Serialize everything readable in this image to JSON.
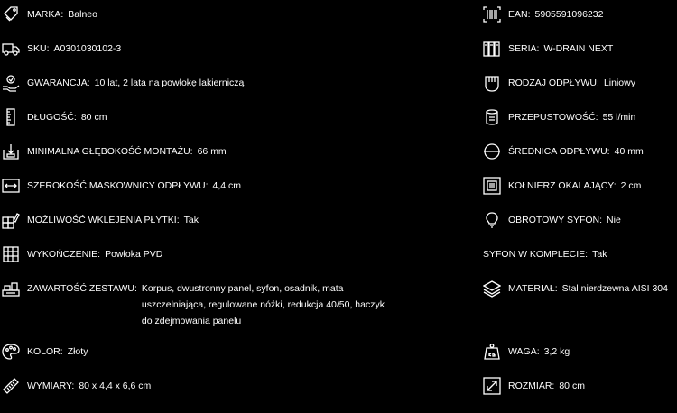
{
  "left": [
    {
      "icon": "tag-icon",
      "label": "MARKA:",
      "value": "Balneo"
    },
    {
      "icon": "truck-icon",
      "label": "SKU:",
      "value": "A0301030102-3"
    },
    {
      "icon": "warranty-hand-icon",
      "label": "GWARANCJA:",
      "value": "10 lat, 2 lata na powłokę lakierniczą"
    },
    {
      "icon": "ruler-icon",
      "label": "DŁUGOŚĆ:",
      "value": "80 cm"
    },
    {
      "icon": "depth-icon",
      "label": "MINIMALNA GŁĘBOKOŚĆ MONTAŻU:",
      "value": "66 mm"
    },
    {
      "icon": "width-icon",
      "label": "SZEROKOŚĆ MASKOWNICY ODPŁYWU:",
      "value": "4,4 cm"
    },
    {
      "icon": "tiles-icon",
      "label": "MOŻLIWOŚĆ WKLEJENIA PŁYTKI:",
      "value": "Tak"
    },
    {
      "icon": "grid-icon",
      "label": "WYKOŃCZENIE:",
      "value": "Powłoka PVD"
    },
    {
      "icon": "box-set-icon",
      "label": "ZAWARTOŚĆ ZESTAWU:",
      "value_lines": [
        "Korpus, dwustronny panel, syfon, osadnik, mata",
        "uszczelniająca, regulowane nóżki, redukcja 40/50, haczyk",
        "do zdejmowania panelu"
      ]
    },
    {
      "icon": "palette-icon",
      "label": "KOLOR:",
      "value": "Złoty"
    },
    {
      "icon": "tape-measure-icon",
      "label": "WYMIARY:",
      "value": "80 x 4,4 x 6,6 cm"
    }
  ],
  "right": [
    {
      "icon": "barcode-icon",
      "label": "EAN:",
      "value": "5905591096232"
    },
    {
      "icon": "books-icon",
      "label": "SERIA:",
      "value": "W-DRAIN NEXT"
    },
    {
      "icon": "drain-type-icon",
      "label": "RODZAJ ODPŁYWU:",
      "value": "Liniowy"
    },
    {
      "icon": "flow-icon",
      "label": "PRZEPUSTOWOŚĆ:",
      "value": "55 l/min"
    },
    {
      "icon": "diameter-icon",
      "label": "ŚREDNICA ODPŁYWU:",
      "value": "40 mm"
    },
    {
      "icon": "collar-icon",
      "label": "KOŁNIERZ OKALAJĄCY:",
      "value": "2 cm"
    },
    {
      "icon": "bulb-icon",
      "label": "OBROTOWY SYFON:",
      "value": "Nie"
    },
    {
      "label": "SYFON W KOMPLECIE:",
      "value": "Tak"
    },
    {
      "icon": "layers-icon",
      "label": "MATERIAŁ:",
      "value": "Stal nierdzewna AISI 304"
    },
    {
      "icon": "weight-icon",
      "label": "WAGA:",
      "value": "3,2 kg"
    },
    {
      "icon": "resize-icon",
      "label": "ROZMIAR:",
      "value": "80 cm"
    }
  ]
}
